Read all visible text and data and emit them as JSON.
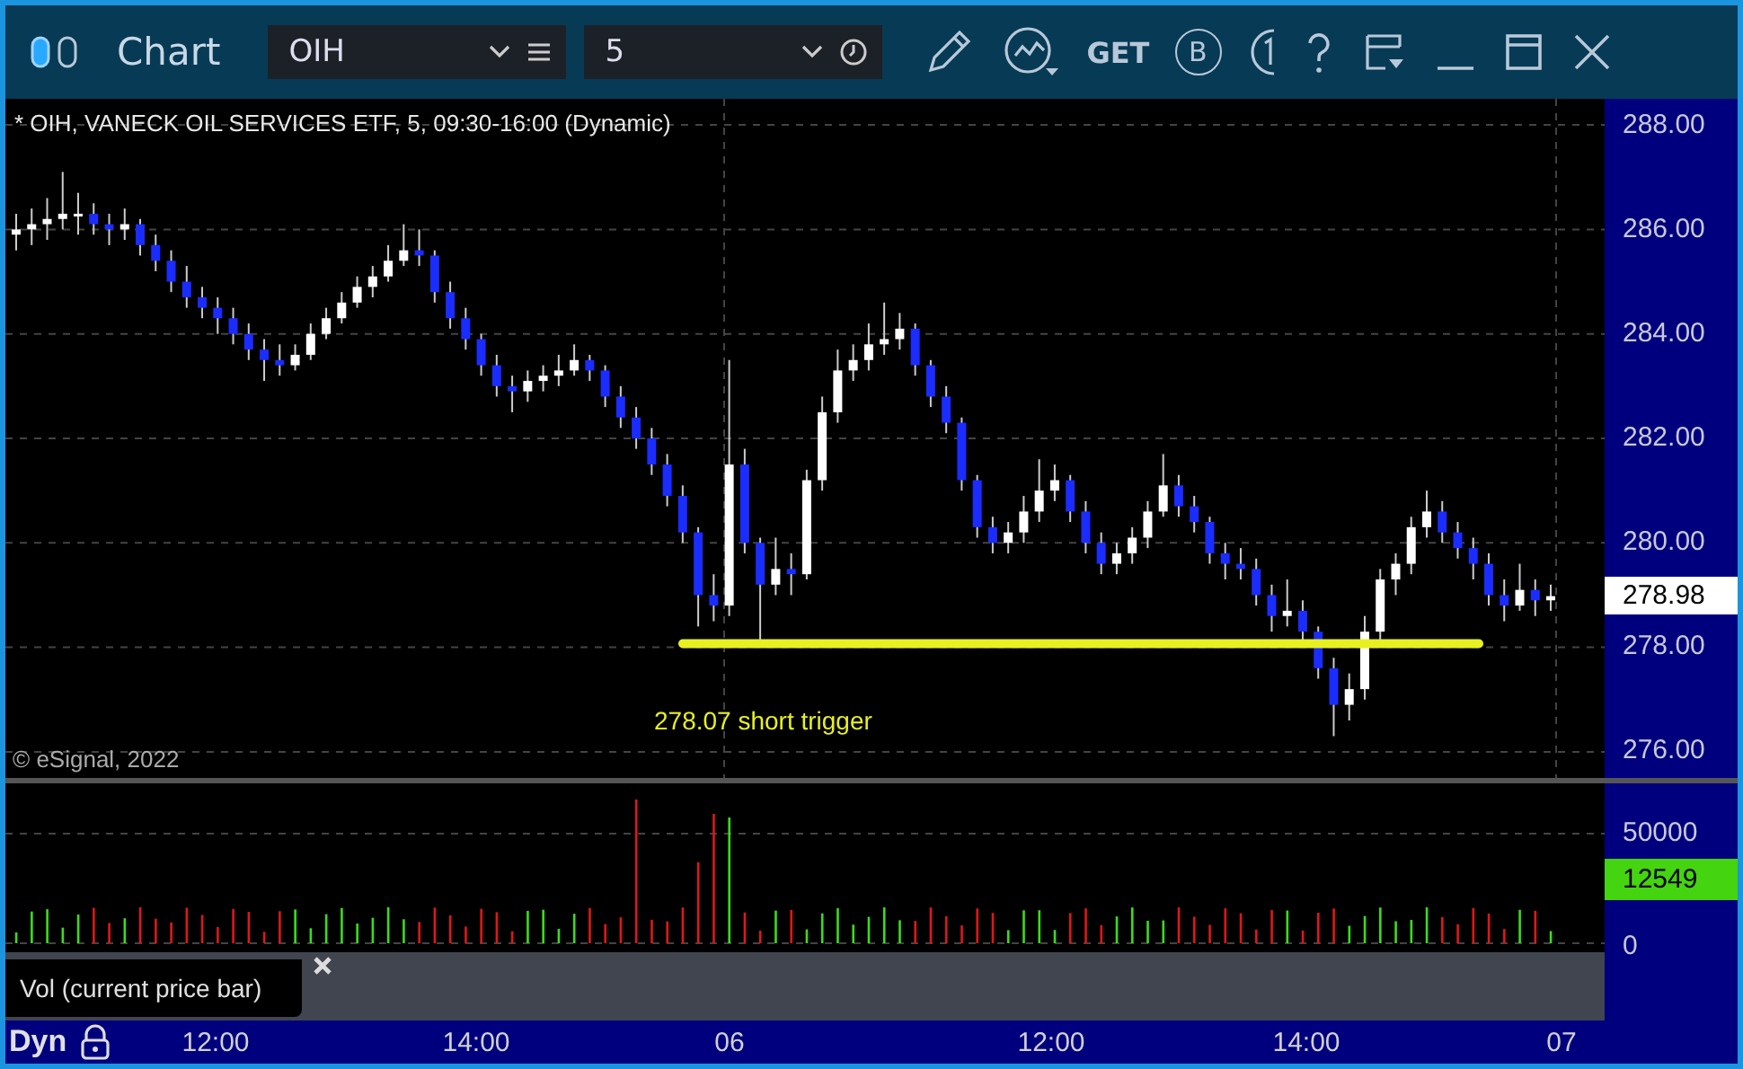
{
  "window": {
    "title": "Chart"
  },
  "toolbar": {
    "symbol": "OIH",
    "interval": "5",
    "get_label": "GET",
    "b_label": "B"
  },
  "chart": {
    "header": "* OIH, VANECK OIL SERVICES ETF, 5, 09:30-16:00 (Dynamic)",
    "copyright": "© eSignal, 2022",
    "current_price": "278.98",
    "chart_data": {
      "type": "candlestick",
      "ylim": [
        275.5,
        288.5
      ],
      "grid": true,
      "ref_lines": [
        {
          "axis": "y",
          "value": 278.07,
          "color": "#e8f020",
          "label": "278.07 short trigger"
        }
      ],
      "yticks": [
        {
          "value": 288,
          "label": "288.00"
        },
        {
          "value": 286,
          "label": "286.00"
        },
        {
          "value": 284,
          "label": "284.00"
        },
        {
          "value": 282,
          "label": "282.00"
        },
        {
          "value": 280,
          "label": "280.00"
        },
        {
          "value": 278,
          "label": "278.00"
        },
        {
          "value": 276,
          "label": "276.00"
        }
      ],
      "ohlc": [
        [
          285.9,
          286.3,
          285.6,
          286.0
        ],
        [
          286.0,
          286.4,
          285.7,
          286.1
        ],
        [
          286.1,
          286.6,
          285.8,
          286.2
        ],
        [
          286.2,
          287.1,
          286.0,
          286.3
        ],
        [
          286.3,
          286.7,
          285.9,
          286.3
        ],
        [
          286.3,
          286.5,
          285.9,
          286.1
        ],
        [
          286.1,
          286.3,
          285.7,
          286.0
        ],
        [
          286.0,
          286.4,
          285.8,
          286.1
        ],
        [
          286.1,
          286.2,
          285.5,
          285.7
        ],
        [
          285.7,
          285.9,
          285.2,
          285.4
        ],
        [
          285.4,
          285.6,
          284.8,
          285.0
        ],
        [
          285.0,
          285.3,
          284.5,
          284.7
        ],
        [
          284.7,
          284.9,
          284.3,
          284.5
        ],
        [
          284.5,
          284.7,
          284.0,
          284.3
        ],
        [
          284.3,
          284.5,
          283.8,
          284.0
        ],
        [
          284.0,
          284.2,
          283.5,
          283.7
        ],
        [
          283.7,
          283.9,
          283.1,
          283.5
        ],
        [
          283.5,
          283.8,
          283.2,
          283.4
        ],
        [
          283.4,
          283.8,
          283.3,
          283.6
        ],
        [
          283.6,
          284.2,
          283.5,
          284.0
        ],
        [
          284.0,
          284.5,
          283.9,
          284.3
        ],
        [
          284.3,
          284.8,
          284.2,
          284.6
        ],
        [
          284.6,
          285.1,
          284.5,
          284.9
        ],
        [
          284.9,
          285.3,
          284.7,
          285.1
        ],
        [
          285.1,
          285.7,
          285.0,
          285.4
        ],
        [
          285.4,
          286.1,
          285.3,
          285.6
        ],
        [
          285.6,
          286.0,
          285.3,
          285.5
        ],
        [
          285.5,
          285.6,
          284.6,
          284.8
        ],
        [
          284.8,
          285.0,
          284.1,
          284.3
        ],
        [
          284.3,
          284.5,
          283.7,
          283.9
        ],
        [
          283.9,
          284.0,
          283.2,
          283.4
        ],
        [
          283.4,
          283.6,
          282.8,
          283.0
        ],
        [
          283.0,
          283.2,
          282.5,
          282.9
        ],
        [
          282.9,
          283.3,
          282.7,
          283.1
        ],
        [
          283.1,
          283.4,
          282.9,
          283.2
        ],
        [
          283.2,
          283.6,
          283.0,
          283.3
        ],
        [
          283.3,
          283.8,
          283.2,
          283.5
        ],
        [
          283.5,
          283.6,
          283.1,
          283.3
        ],
        [
          283.3,
          283.4,
          282.6,
          282.8
        ],
        [
          282.8,
          283.0,
          282.2,
          282.4
        ],
        [
          282.4,
          282.6,
          281.8,
          282.0
        ],
        [
          282.0,
          282.2,
          281.3,
          281.5
        ],
        [
          281.5,
          281.7,
          280.7,
          280.9
        ],
        [
          280.9,
          281.1,
          280.0,
          280.2
        ],
        [
          280.2,
          280.3,
          278.4,
          279.0
        ],
        [
          279.0,
          279.4,
          278.5,
          278.8
        ],
        [
          278.8,
          283.5,
          278.6,
          281.5
        ],
        [
          281.5,
          281.8,
          279.8,
          280.0
        ],
        [
          280.0,
          280.1,
          278.1,
          279.2
        ],
        [
          279.2,
          280.1,
          279.0,
          279.5
        ],
        [
          279.5,
          279.8,
          279.0,
          279.4
        ],
        [
          279.4,
          281.4,
          279.3,
          281.2
        ],
        [
          281.2,
          282.8,
          281.0,
          282.5
        ],
        [
          282.5,
          283.7,
          282.3,
          283.3
        ],
        [
          283.3,
          283.8,
          283.1,
          283.5
        ],
        [
          283.5,
          284.2,
          283.3,
          283.8
        ],
        [
          283.8,
          284.6,
          283.6,
          283.9
        ],
        [
          283.9,
          284.4,
          283.7,
          284.1
        ],
        [
          284.1,
          284.2,
          283.2,
          283.4
        ],
        [
          283.4,
          283.5,
          282.6,
          282.8
        ],
        [
          282.8,
          283.0,
          282.1,
          282.3
        ],
        [
          282.3,
          282.4,
          281.0,
          281.2
        ],
        [
          281.2,
          281.3,
          280.1,
          280.3
        ],
        [
          280.3,
          280.5,
          279.8,
          280.0
        ],
        [
          280.0,
          280.4,
          279.8,
          280.2
        ],
        [
          280.2,
          280.9,
          280.0,
          280.6
        ],
        [
          280.6,
          281.6,
          280.4,
          281.0
        ],
        [
          281.0,
          281.5,
          280.8,
          281.2
        ],
        [
          281.2,
          281.3,
          280.4,
          280.6
        ],
        [
          280.6,
          280.8,
          279.8,
          280.0
        ],
        [
          280.0,
          280.2,
          279.4,
          279.6
        ],
        [
          279.6,
          280.0,
          279.4,
          279.8
        ],
        [
          279.8,
          280.3,
          279.6,
          280.1
        ],
        [
          280.1,
          280.8,
          279.9,
          280.6
        ],
        [
          280.6,
          281.7,
          280.5,
          281.1
        ],
        [
          281.1,
          281.3,
          280.5,
          280.7
        ],
        [
          280.7,
          280.9,
          280.2,
          280.4
        ],
        [
          280.4,
          280.5,
          279.6,
          279.8
        ],
        [
          279.8,
          280.0,
          279.3,
          279.6
        ],
        [
          279.6,
          279.9,
          279.3,
          279.5
        ],
        [
          279.5,
          279.7,
          278.8,
          279.0
        ],
        [
          279.0,
          279.2,
          278.3,
          278.6
        ],
        [
          278.6,
          279.3,
          278.4,
          278.7
        ],
        [
          278.7,
          278.9,
          278.1,
          278.3
        ],
        [
          278.3,
          278.4,
          277.4,
          277.6
        ],
        [
          277.6,
          277.8,
          276.3,
          276.9
        ],
        [
          276.9,
          277.5,
          276.6,
          277.2
        ],
        [
          277.2,
          278.6,
          277.0,
          278.3
        ],
        [
          278.3,
          279.5,
          278.1,
          279.3
        ],
        [
          279.3,
          279.8,
          279.0,
          279.6
        ],
        [
          279.6,
          280.5,
          279.4,
          280.3
        ],
        [
          280.3,
          281.0,
          280.1,
          280.6
        ],
        [
          280.6,
          280.8,
          280.0,
          280.2
        ],
        [
          280.2,
          280.4,
          279.7,
          279.9
        ],
        [
          279.9,
          280.1,
          279.3,
          279.6
        ],
        [
          279.6,
          279.8,
          278.8,
          279.0
        ],
        [
          279.0,
          279.3,
          278.5,
          278.8
        ],
        [
          278.8,
          279.6,
          278.7,
          279.1
        ],
        [
          279.1,
          279.3,
          278.6,
          278.9
        ],
        [
          278.9,
          279.2,
          278.7,
          278.98
        ]
      ]
    }
  },
  "volume": {
    "ticks": [
      "50000",
      "0"
    ],
    "current_volume": "12549",
    "legend": "Vol (current price bar)"
  },
  "time_axis": {
    "mode": "Dyn",
    "labels": [
      "12:00",
      "14:00",
      "06",
      "12:00",
      "14:00",
      "07"
    ]
  }
}
